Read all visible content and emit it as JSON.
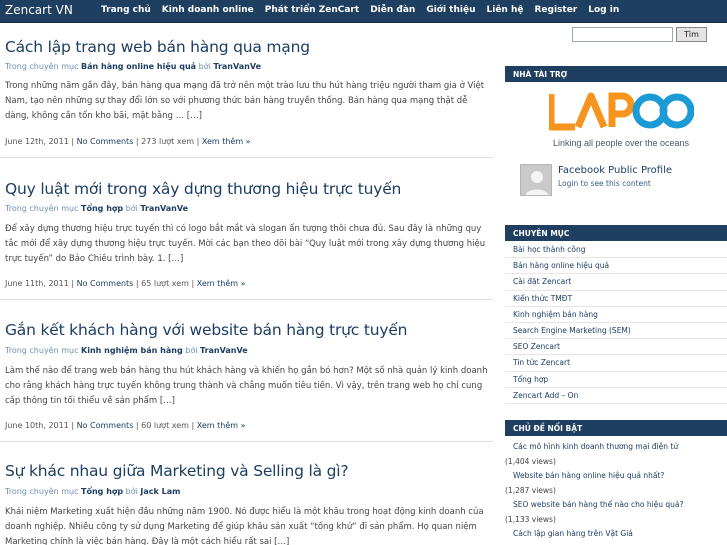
{
  "header": {
    "brand": "Zencart VN",
    "nav": [
      "Trang chủ",
      "Kinh doanh online",
      "Phát triển ZenCart",
      "Diễn đàn",
      "Giới thiệu",
      "Liên hệ",
      "Register",
      "Log in"
    ]
  },
  "posts": [
    {
      "title": "Cách lập trang web bán hàng qua mạng",
      "meta_prefix": "Trong chuyên mục",
      "category": "Bán hàng online hiệu quả",
      "by": "bởi",
      "author": "TranVanVe",
      "excerpt": "Trong những năm gần đây, bán hàng qua mạng đã trở nên một trào lưu thu hút hàng triệu người tham gia ở Việt Nam, tạo nên những sự thay đổi lớn so với phương thức bán hàng truyền thống. Bán hàng qua mạng thật dễ dàng, không cần tốn kho bãi, mặt bằng … […]",
      "date": "June 12th, 2011",
      "comments": "No Comments",
      "views": "273 lượt xem",
      "more": "Xem thêm »"
    },
    {
      "title": "Quy luật mới trong xây dựng thương hiệu trực tuyến",
      "meta_prefix": "Trong chuyên mục",
      "category": "Tổng hợp",
      "by": "bởi",
      "author": "TranVanVe",
      "excerpt": "Để xây dựng thương hiệu trực tuyến thì có logo bắt mắt và slogan ấn tượng thôi chưa đủ. Sau đây là những quy tắc mới để xây dựng thương hiệu trực tuyến. Mời các bạn theo dõi bài “Quy luật mới trong xây dựng thương hiệu trực tuyến” do Bảo Chiêu trình bày. 1. […]",
      "date": "June 11th, 2011",
      "comments": "No Comments",
      "views": "65 lượt xem",
      "more": "Xem thêm »"
    },
    {
      "title": "Gắn kết khách hàng với website bán hàng trực tuyến",
      "meta_prefix": "Trong chuyên mục",
      "category": "Kinh nghiệm bán hàng",
      "by": "bởi",
      "author": "TranVanVe",
      "excerpt": "Làm thế nào để trang web bán hàng thu hút khách hàng và khiến họ gắn bó hơn? Một số nhà quản lý kinh doanh cho rằng khách hàng trực tuyến không trung thành và chẳng muốn tiêu tiền. Vì vậy, trên trang web họ chỉ cung cấp thông tin tối thiểu về sản phẩm […]",
      "date": "June 10th, 2011",
      "comments": "No Comments",
      "views": "60 lượt xem",
      "more": "Xem thêm »"
    },
    {
      "title": "Sự khác nhau giữa Marketing và Selling là gì?",
      "meta_prefix": "Trong chuyên mục",
      "category": "Tổng hợp",
      "by": "bởi",
      "author": "Jack Lam",
      "excerpt": "Khái niệm Marketing xuất hiện đầu những năm 1900. Nó được hiểu là một khâu trong hoạt động kinh doanh của doanh nghiệp. Nhiều công ty sử dụng Marketing để giúp khâu sản xuất “tống khứ” đi sản phẩm. Họ quan niệm Marketing chính là việc bán hàng. Đây là một cách hiểu rất sai […]"
    }
  ],
  "sidebar": {
    "search_button": "Tìm",
    "sponsor_heading": "NHÀ TÀI TRỢ",
    "sponsor_logo": "LAPOO",
    "sponsor_tagline": "Linking all people over the oceans",
    "fb_title": "Facebook Public Profile",
    "fb_sub": "Login to see this content",
    "categories_heading": "CHUYÊN MỤC",
    "categories": [
      "Bài học thành công",
      "Bán hàng online hiệu quả",
      "Cài đặt Zencart",
      "Kiến thức TMĐT",
      "Kinh nghiệm bán hàng",
      "Search Engine Marketing (SEM)",
      "SEO Zencart",
      "Tin tức Zencart",
      "Tổng hợp",
      "Zencart Add – On"
    ],
    "popular_heading": "CHỦ ĐỀ NỔI BẬT",
    "popular": [
      {
        "title": "Các mô hình kinh doanh thương mại điện tử",
        "views": "(1,404 views)"
      },
      {
        "title": "Website bán hàng online hiệu quả nhất?",
        "views": "(1,287 views)"
      },
      {
        "title": "SEO website bán hàng thế nào cho hiệu quả?",
        "views": "(1,133 views)"
      },
      {
        "title": "Cách lập gian hàng trên Vật Giá",
        "views": ""
      }
    ]
  },
  "colors": {
    "nav_bg": "#1f3f60",
    "link": "#1d3e62",
    "meta": "#6e8fb3",
    "logo_orange": "#f7941d",
    "logo_blue": "#1b9ad6"
  }
}
